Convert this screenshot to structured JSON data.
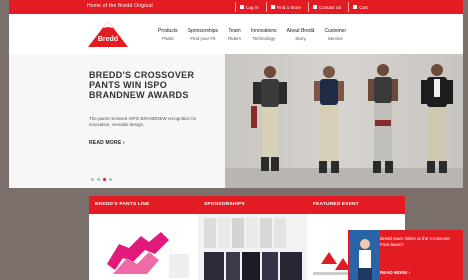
{
  "topbar": {
    "tagline": "Home of the Bredd Original",
    "links": [
      {
        "label": "Log In",
        "icon": "user-icon"
      },
      {
        "label": "Find a Store",
        "icon": "pin-icon"
      },
      {
        "label": "Contact Us",
        "icon": "mail-icon"
      },
      {
        "label": "Cart",
        "icon": "cart-icon"
      }
    ]
  },
  "header": {
    "logo_alt": "Bredd",
    "nav": [
      {
        "label": "Products",
        "sub": "Pants"
      },
      {
        "label": "Sponsorships",
        "sub": "Find your Fit"
      },
      {
        "label": "Team",
        "sub": "Riders"
      },
      {
        "label": "Innovations",
        "sub": "Technology"
      },
      {
        "label": "About Bredd",
        "sub": "Story"
      },
      {
        "label": "Customer",
        "sub": "Service"
      }
    ]
  },
  "hero": {
    "title": "BREDD'S CROSSOVER PANTS WIN ISPO BRANDNEW AWARDS",
    "body": "The pants received ISPO BRANDNEW recognition for innovative, versatile design.",
    "more": "READ MORE",
    "slide_count": 4,
    "active_slide": 3
  },
  "cards": [
    {
      "title": "BREDD'S PANTS LINE"
    },
    {
      "title": "SPONSORSHIPS"
    },
    {
      "title": "FEATURED EVENT"
    }
  ],
  "promo": {
    "text": "Bredd team riders at the Crossover Pant launch",
    "more": "READ MORE"
  },
  "colors": {
    "brand_red": "#e31b23",
    "backdrop": "#7a6f6a"
  }
}
